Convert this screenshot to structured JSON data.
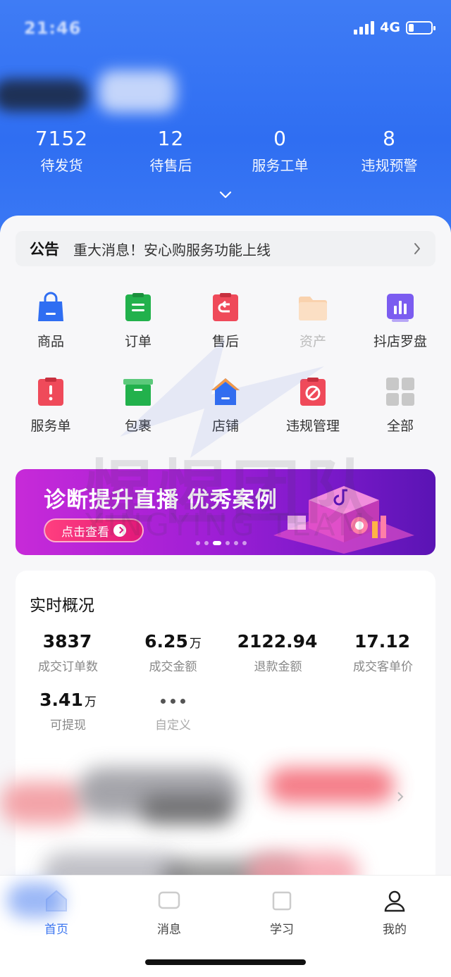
{
  "status_bar": {
    "time": "21:46",
    "network": "4G"
  },
  "stats": [
    {
      "value": "7152",
      "label": "待发货"
    },
    {
      "value": "12",
      "label": "待售后"
    },
    {
      "value": "0",
      "label": "服务工单"
    },
    {
      "value": "8",
      "label": "违规预警"
    }
  ],
  "notice": {
    "tag": "公告",
    "text": "重大消息！安心购服务功能上线"
  },
  "grid": [
    {
      "label": "商品",
      "icon": "shopping-bag-icon",
      "color": "#2f6ef2"
    },
    {
      "label": "订单",
      "icon": "order-clipboard-icon",
      "color": "#22b14c"
    },
    {
      "label": "售后",
      "icon": "after-sales-icon",
      "color": "#ef4a5a"
    },
    {
      "label": "资产",
      "icon": "assets-folder-icon",
      "color": "#f9c9a2"
    },
    {
      "label": "抖店罗盘",
      "icon": "compass-chart-icon",
      "color": "#7b5cf0"
    },
    {
      "label": "服务单",
      "icon": "service-ticket-icon",
      "color": "#ef4a5a"
    },
    {
      "label": "包裹",
      "icon": "package-box-icon",
      "color": "#22b14c"
    },
    {
      "label": "店铺",
      "icon": "store-house-icon",
      "color": "#2f6ef2"
    },
    {
      "label": "违规管理",
      "icon": "violation-icon",
      "color": "#ef4a5a"
    },
    {
      "label": "全部",
      "icon": "all-grid-icon",
      "color": "#c8c8c8"
    }
  ],
  "banner": {
    "title": "诊断提升直播 优秀案例",
    "button": "点击查看"
  },
  "watermark": {
    "cn": "惺惺团队",
    "en": "XINGYING TEAM"
  },
  "realtime": {
    "title": "实时概况",
    "items": [
      {
        "value": "3837",
        "unit": "",
        "label": "成交订单数"
      },
      {
        "value": "6.25",
        "unit": "万",
        "label": "成交金额"
      },
      {
        "value": "2122.94",
        "unit": "",
        "label": "退款金额"
      },
      {
        "value": "17.12",
        "unit": "",
        "label": "成交客单价"
      },
      {
        "value": "3.41",
        "unit": "万",
        "label": "可提现"
      }
    ],
    "custom_label": "自定义"
  },
  "tabbar": [
    {
      "label": "首页",
      "icon": "home-icon",
      "active": true
    },
    {
      "label": "消息",
      "icon": "message-icon",
      "active": false
    },
    {
      "label": "学习",
      "icon": "learn-icon",
      "active": false
    },
    {
      "label": "我的",
      "icon": "profile-icon",
      "active": false
    }
  ],
  "colors": {
    "header_blue": "#3a78f4",
    "accent_blue": "#3b75f0",
    "banner_purple": "#a11fd6"
  }
}
